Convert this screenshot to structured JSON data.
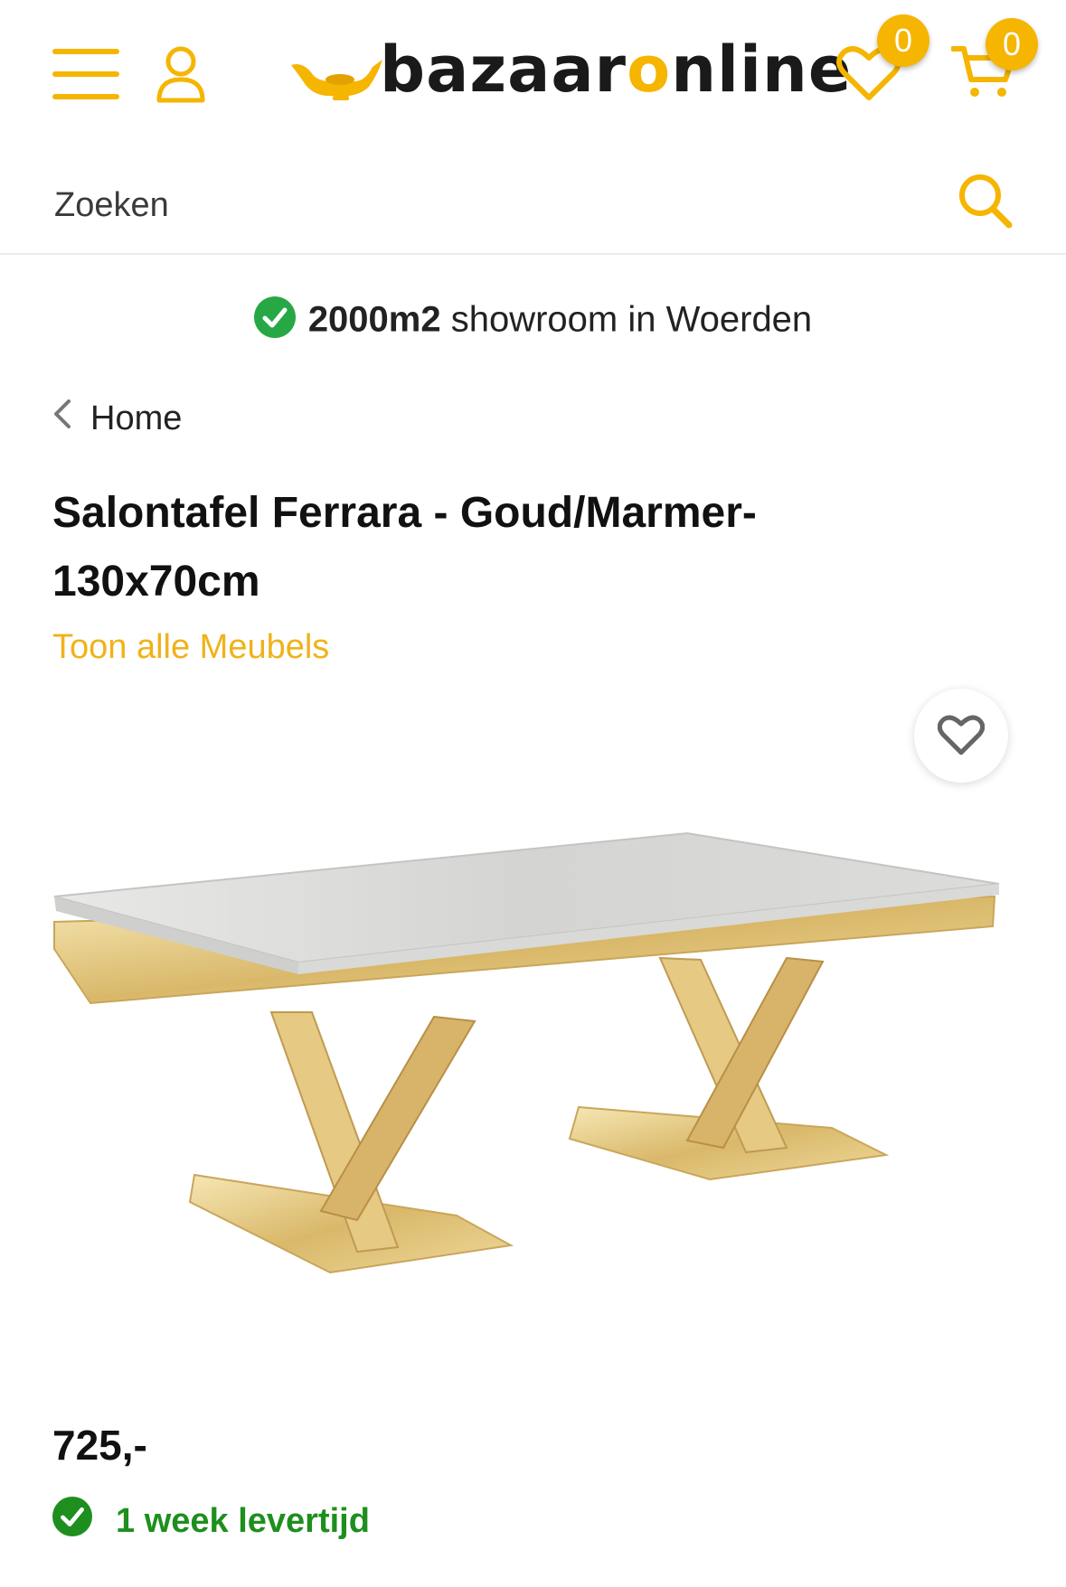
{
  "header": {
    "menu_icon": "hamburger-menu-icon",
    "account_icon": "user-icon",
    "logo": {
      "text_before": "bazaar",
      "text_accent": "o",
      "text_after": "nline",
      "icon": "magic-lamp-icon"
    },
    "wishlist": {
      "icon": "heart-icon",
      "count": "0"
    },
    "cart": {
      "icon": "cart-icon",
      "count": "0"
    }
  },
  "search": {
    "placeholder": "Zoeken",
    "icon": "search-icon"
  },
  "usp": {
    "strong": "2000m2",
    "text": " showroom in Woerden",
    "icon": "check-circle-icon"
  },
  "breadcrumb": {
    "label": "Home",
    "icon": "chevron-left-icon"
  },
  "product": {
    "title": "Salontafel Ferrara - Goud/Marmer-130x70cm",
    "category_link": "Toon alle Meubels",
    "price": "725,-",
    "delivery": "1 week levertijd",
    "favorite_icon": "heart-outline-icon"
  },
  "colors": {
    "accent": "#f5b500",
    "link": "#f0b21a",
    "success": "#1e8f1e",
    "check_bg": "#27a844"
  }
}
